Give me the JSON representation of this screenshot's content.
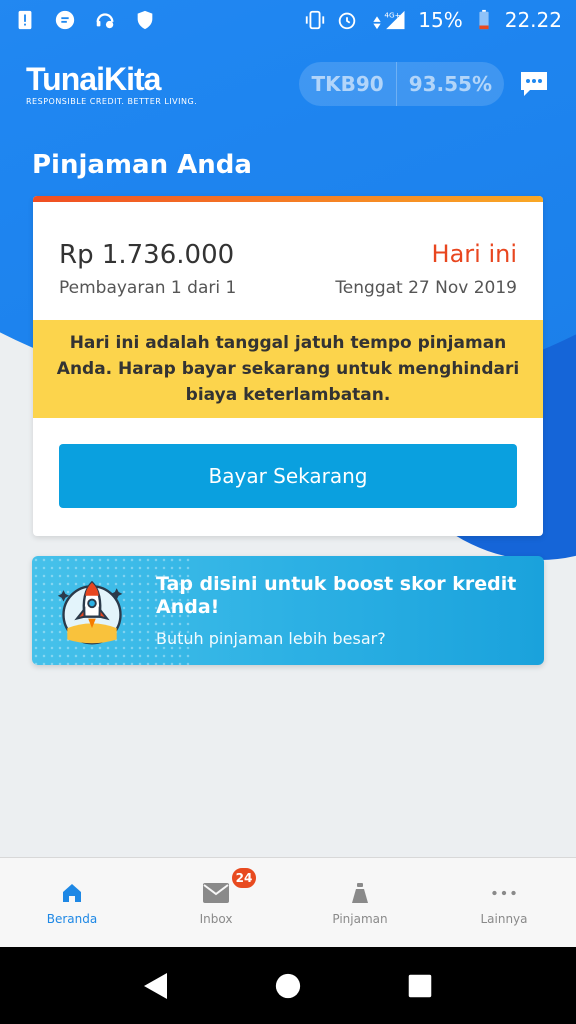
{
  "status_bar": {
    "battery": "15%",
    "time": "22.22",
    "network": "4G+"
  },
  "header": {
    "brand_name": "TunaiKita",
    "brand_tagline": "RESPONSIBLE CREDIT. BETTER LIVING.",
    "score_label": "TKB90",
    "score_value": "93.55%"
  },
  "page_title": "Pinjaman Anda",
  "loan": {
    "amount": "Rp 1.736.000",
    "installment": "Pembayaran 1 dari 1",
    "due_status": "Hari ini",
    "due_date": "Tenggat 27 Nov 2019",
    "warning": "Hari ini adalah tanggal jatuh tempo pinjaman Anda. Harap bayar sekarang untuk menghindari biaya keterlambatan.",
    "pay_button": "Bayar Sekarang"
  },
  "boost": {
    "title": "Tap disini untuk boost skor kredit Anda!",
    "subtitle": "Butuh pinjaman lebih besar?"
  },
  "bottom_nav": {
    "items": [
      {
        "label": "Beranda"
      },
      {
        "label": "Inbox"
      },
      {
        "label": "Pinjaman"
      },
      {
        "label": "Lainnya"
      }
    ],
    "inbox_badge": "24"
  },
  "colors": {
    "primary_blue": "#1e88f0",
    "accent_orange": "#e8461f",
    "warning_yellow": "#fcd44c",
    "button_blue": "#0aa0df"
  }
}
